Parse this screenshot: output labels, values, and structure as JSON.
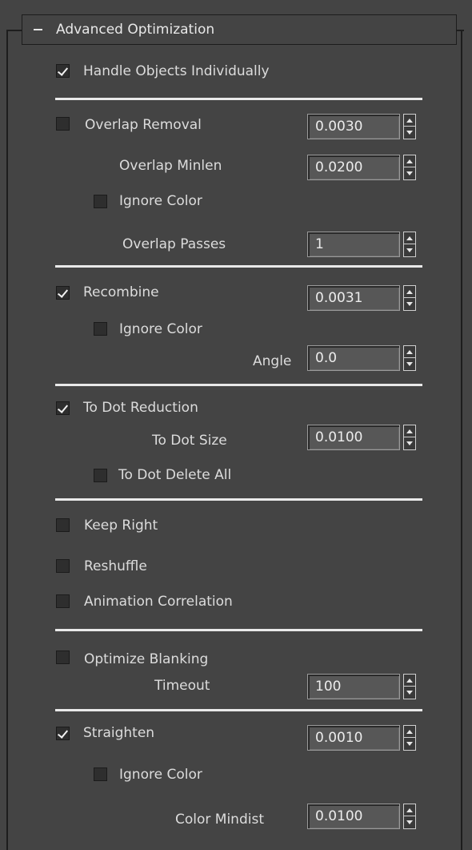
{
  "rollout": {
    "title": "Advanced Optimization"
  },
  "handle_objects": {
    "label": "Handle Objects Individually",
    "checked": true
  },
  "overlap": {
    "removal": {
      "label": "Overlap Removal",
      "checked": false,
      "value": "0.0030"
    },
    "minlen": {
      "label": "Overlap Minlen",
      "value": "0.0200"
    },
    "ignore_color": {
      "label": "Ignore Color",
      "checked": false
    },
    "passes": {
      "label": "Overlap Passes",
      "value": "1"
    }
  },
  "recombine": {
    "label": "Recombine",
    "checked": true,
    "value": "0.0031",
    "ignore_color": {
      "label": "Ignore Color",
      "checked": false
    },
    "angle": {
      "label": "Angle",
      "value": "0.0"
    }
  },
  "to_dot": {
    "reduction": {
      "label": "To Dot Reduction",
      "checked": true
    },
    "size": {
      "label": "To Dot Size",
      "value": "0.0100"
    },
    "delete_all": {
      "label": "To Dot Delete All",
      "checked": false
    }
  },
  "keep_right": {
    "label": "Keep Right",
    "checked": false
  },
  "reshuffle": {
    "label": "Reshuffle",
    "checked": false
  },
  "animation_correlation": {
    "label": "Animation Correlation",
    "checked": false
  },
  "blanking": {
    "label": "Optimize Blanking",
    "checked": false,
    "timeout": {
      "label": "Timeout",
      "value": "100"
    }
  },
  "straighten": {
    "label": "Straighten",
    "checked": true,
    "value": "0.0010",
    "ignore_color": {
      "label": "Ignore Color",
      "checked": false
    },
    "color_mindist": {
      "label": "Color Mindist",
      "value": "0.0100"
    }
  },
  "colors": {
    "panel_bg": "#444444",
    "field_bg": "#575757",
    "separator": "#e9e9e9"
  }
}
